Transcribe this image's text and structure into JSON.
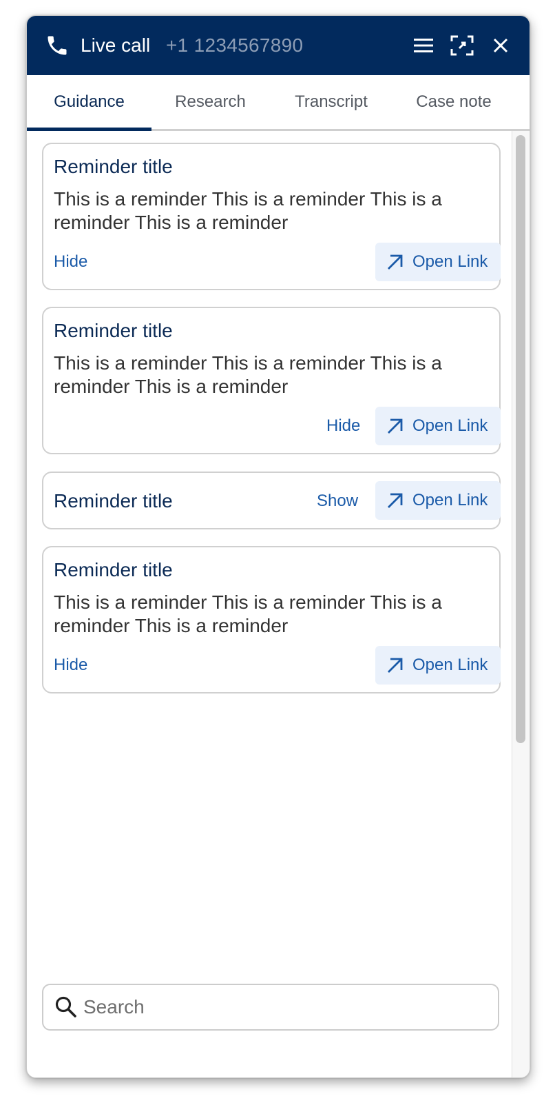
{
  "header": {
    "title": "Live call",
    "phone_number": "+1 1234567890",
    "icons": [
      "phone-icon",
      "menu-icon",
      "expand-icon",
      "close-icon"
    ],
    "background": "#022a5d"
  },
  "tabs": [
    {
      "label": "Guidance",
      "active": true
    },
    {
      "label": "Research",
      "active": false
    },
    {
      "label": "Transcript",
      "active": false
    },
    {
      "label": "Case note",
      "active": false
    }
  ],
  "cards": [
    {
      "title": "Reminder title",
      "text": "This is a reminder This is a reminder This is a reminder This is a reminder",
      "toggle": "Hide",
      "open_link": "Open Link"
    },
    {
      "title": "Reminder title",
      "text": "This is a reminder This is a reminder This is a reminder This is a reminder",
      "toggle": "Hide",
      "open_link": "Open Link"
    },
    {
      "title": "Reminder title",
      "toggle": "Show",
      "open_link": "Open Link"
    },
    {
      "title": "Reminder title",
      "text": "This is a reminder This is a reminder This is a reminder This is a reminder",
      "toggle": "Hide",
      "open_link": "Open Link"
    }
  ],
  "search": {
    "placeholder": "Search",
    "value": ""
  },
  "colors": {
    "accent": "#022a5d",
    "link": "#1a5aa8",
    "link_bg": "#eaf1fb",
    "border": "#d0d0d0"
  }
}
